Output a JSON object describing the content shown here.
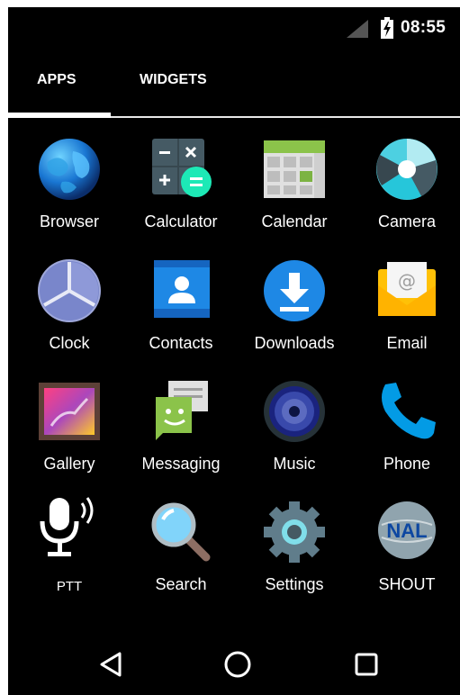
{
  "status_bar": {
    "time": "08:55"
  },
  "tabs": [
    {
      "label": "APPS",
      "selected": true
    },
    {
      "label": "WIDGETS",
      "selected": false
    }
  ],
  "apps": [
    {
      "label": "Browser",
      "icon": "globe-icon"
    },
    {
      "label": "Calculator",
      "icon": "calculator-icon"
    },
    {
      "label": "Calendar",
      "icon": "calendar-icon"
    },
    {
      "label": "Camera",
      "icon": "camera-aperture-icon"
    },
    {
      "label": "Clock",
      "icon": "clock-icon"
    },
    {
      "label": "Contacts",
      "icon": "contacts-icon"
    },
    {
      "label": "Downloads",
      "icon": "download-icon"
    },
    {
      "label": "Email",
      "icon": "envelope-icon"
    },
    {
      "label": "Gallery",
      "icon": "gallery-icon"
    },
    {
      "label": "Messaging",
      "icon": "messaging-icon"
    },
    {
      "label": "Music",
      "icon": "speaker-icon"
    },
    {
      "label": "Phone",
      "icon": "phone-icon"
    },
    {
      "label": "PTT",
      "icon": "microphone-icon"
    },
    {
      "label": "Search",
      "icon": "magnifier-icon"
    },
    {
      "label": "Settings",
      "icon": "gear-icon"
    },
    {
      "label": "SHOUT",
      "icon": "shout-nal-icon",
      "logo_text": "NAL"
    }
  ],
  "nav": {
    "back": "back-icon",
    "home": "home-icon",
    "recents": "recents-icon"
  },
  "colors": {
    "background": "#000000",
    "text": "#ffffff",
    "accent_teal": "#2ec9b7",
    "accent_blue": "#1e88e5"
  }
}
